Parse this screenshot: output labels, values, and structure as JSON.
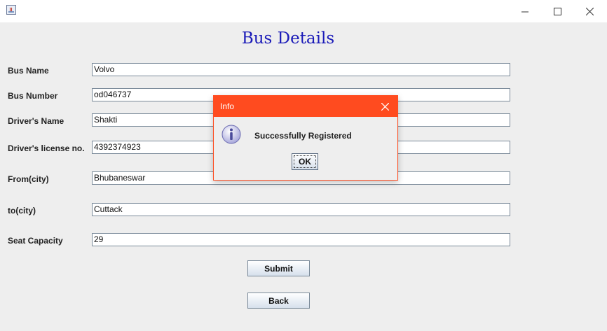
{
  "window": {
    "title": "",
    "controls": {
      "minimize_icon": "minimize-icon",
      "maximize_icon": "maximize-icon",
      "close_icon": "close-icon"
    }
  },
  "form": {
    "title": "Bus Details",
    "fields": [
      {
        "label": "Bus Name",
        "value": "Volvo"
      },
      {
        "label": "Bus Number",
        "value": "od046737"
      },
      {
        "label": "Driver's Name",
        "value": "Shakti"
      },
      {
        "label": "Driver's license no.",
        "value": "4392374923"
      },
      {
        "label": "From(city)",
        "value": "Bhubaneswar"
      },
      {
        "label": "to(city)",
        "value": "Cuttack"
      },
      {
        "label": "Seat Capacity",
        "value": "29"
      }
    ],
    "submit_label": "Submit",
    "back_label": "Back"
  },
  "dialog": {
    "title": "Info",
    "message": "Successfully Registered",
    "ok_label": "OK",
    "icon": "info-icon",
    "accent": "#ff4b1f"
  },
  "colors": {
    "title_text": "#1a1ab8",
    "background": "#eeeeee",
    "dialog_titlebar": "#ff4b1f"
  }
}
